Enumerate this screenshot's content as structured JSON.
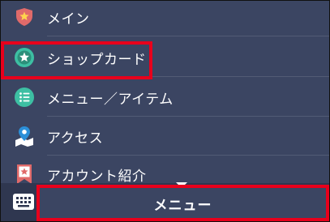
{
  "menu": {
    "items": [
      {
        "label": "メイン",
        "icon": "shield-star-icon"
      },
      {
        "label": "ショップカード",
        "icon": "star-badge-icon"
      },
      {
        "label": "メニュー／アイテム",
        "icon": "list-icon"
      },
      {
        "label": "アクセス",
        "icon": "map-pin-icon"
      },
      {
        "label": "アカウント紹介",
        "icon": "bookmark-star-icon"
      }
    ]
  },
  "bottom_bar": {
    "keyboard_icon": "keyboard-icon",
    "menu_label": "メニュー"
  },
  "colors": {
    "background": "#3b4562",
    "bottom_bar": "#2f3750",
    "highlight": "#e8001c",
    "shield": "#e06a6a",
    "star_badge": "#3dbfa3",
    "list": "#3dbfa3",
    "map_pin": "#2b8fd8",
    "bookmark": "#e06a6a"
  }
}
